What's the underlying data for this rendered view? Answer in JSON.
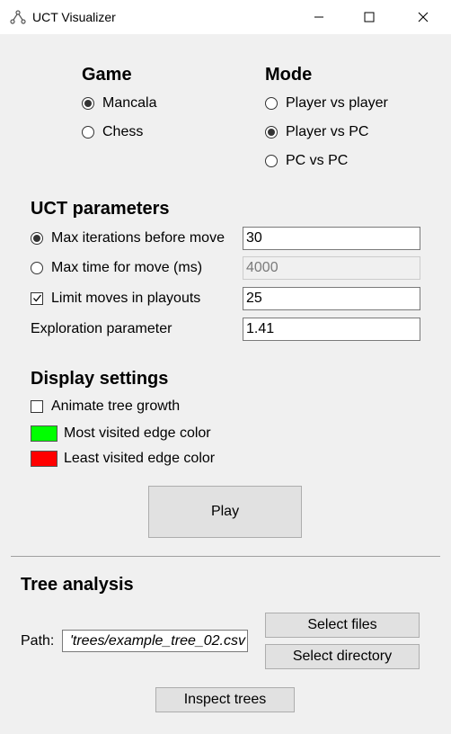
{
  "window": {
    "title": "UCT Visualizer",
    "icon": "tree-icon"
  },
  "game": {
    "heading": "Game",
    "options": [
      {
        "label": "Mancala",
        "checked": true
      },
      {
        "label": "Chess",
        "checked": false
      }
    ]
  },
  "mode": {
    "heading": "Mode",
    "options": [
      {
        "label": "Player vs player",
        "checked": false
      },
      {
        "label": "Player vs PC",
        "checked": true
      },
      {
        "label": "PC vs PC",
        "checked": false
      }
    ]
  },
  "uct": {
    "heading": "UCT parameters",
    "max_iterations": {
      "label": "Max iterations before move",
      "value": "30",
      "checked": true
    },
    "max_time": {
      "label": "Max time for move (ms)",
      "value": "4000",
      "checked": false,
      "disabled": true
    },
    "limit_moves": {
      "label": "Limit moves in playouts",
      "value": "25",
      "checked": true
    },
    "exploration": {
      "label": "Exploration parameter",
      "value": "1.41"
    }
  },
  "display": {
    "heading": "Display settings",
    "animate": {
      "label": "Animate tree growth",
      "checked": false
    },
    "most_visited": {
      "label": "Most visited edge color",
      "color": "#00ff00"
    },
    "least_visited": {
      "label": "Least visited edge color",
      "color": "#ff0000"
    }
  },
  "play_button": "Play",
  "tree_analysis": {
    "heading": "Tree analysis",
    "path_label": "Path:",
    "path_value": "'trees/example_tree_02.csv",
    "select_files": "Select files",
    "select_directory": "Select directory",
    "inspect": "Inspect trees"
  }
}
